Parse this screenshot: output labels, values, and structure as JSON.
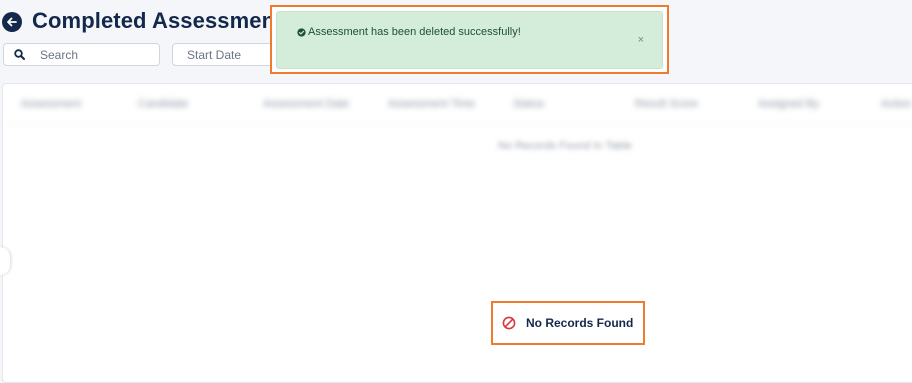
{
  "header": {
    "title": "Completed Assessments",
    "back_icon": "arrow-left-icon"
  },
  "filters": {
    "search_placeholder": "Search",
    "start_date_placeholder": "Start Date"
  },
  "table": {
    "blurred_columns": [
      "Assessment",
      "Candidate",
      "Assessment Date",
      "Assessment Time",
      "Status",
      "Result Score",
      "Assigned By",
      "Action"
    ],
    "blurred_empty_text": "No Records Found In Table"
  },
  "empty_state": {
    "icon": "ban-icon",
    "text": "No Records Found",
    "icon_color": "#d9363e"
  },
  "toast": {
    "message": "Assessment has been deleted successfully!",
    "icon": "check-circle-icon",
    "close_label": "×",
    "background": "#d4edda"
  },
  "colors": {
    "primary": "#14284b",
    "highlight": "#f07b2c"
  }
}
